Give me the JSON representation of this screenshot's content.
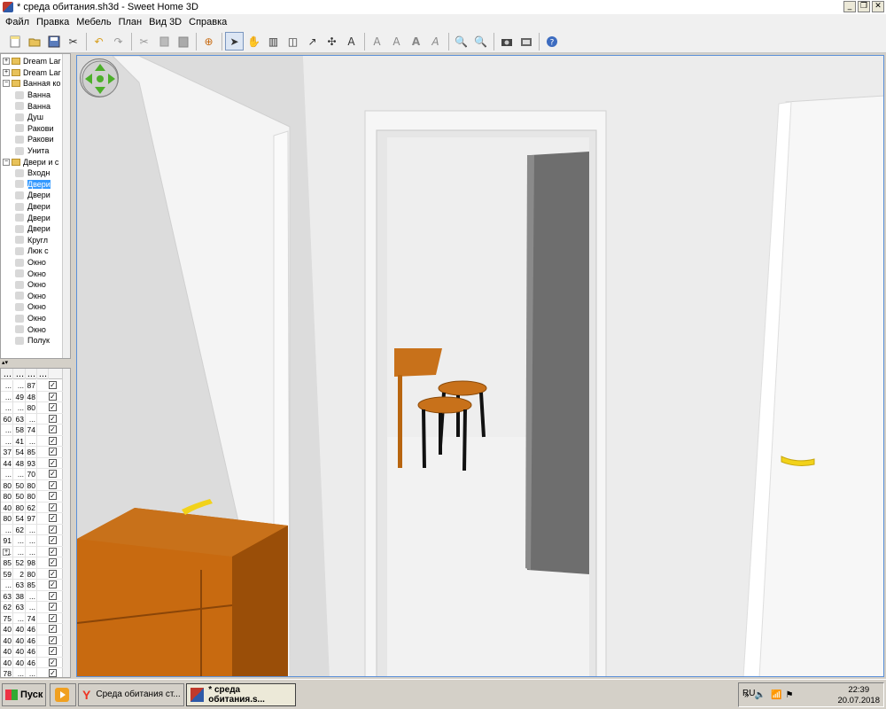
{
  "window": {
    "title": "* среда обитания.sh3d - Sweet Home 3D"
  },
  "menu": [
    "Файл",
    "Правка",
    "Мебель",
    "План",
    "Вид 3D",
    "Справка"
  ],
  "toolbar_icons": [
    "new-file-icon",
    "open-file-icon",
    "save-icon",
    "cut-icon",
    "undo-icon",
    "redo-icon",
    "cut2-icon",
    "copy-icon",
    "paste-icon",
    "add-furniture-icon",
    "select-icon",
    "pan-icon",
    "create-walls-icon",
    "create-rooms-icon",
    "create-dimensions-icon",
    "create-polylines-icon",
    "add-text-icon",
    "text-style-a-icon",
    "text-style-b-icon",
    "text-bold-icon",
    "text-italic-icon",
    "zoom-in-icon",
    "zoom-out-icon",
    "photo-icon",
    "video-icon",
    "help-icon"
  ],
  "catalog": [
    {
      "label": "Dream Lar",
      "type": "folder",
      "indent": 0,
      "exp": "+"
    },
    {
      "label": "Dream Lar",
      "type": "folder",
      "indent": 0,
      "exp": "+"
    },
    {
      "label": "Ванная ко",
      "type": "folder",
      "indent": 0,
      "exp": "−"
    },
    {
      "label": "Ванна",
      "type": "item",
      "indent": 1
    },
    {
      "label": "Ванна",
      "type": "item",
      "indent": 1
    },
    {
      "label": "Душ",
      "type": "item",
      "indent": 1
    },
    {
      "label": "Ракови",
      "type": "item",
      "indent": 1
    },
    {
      "label": "Ракови",
      "type": "item",
      "indent": 1
    },
    {
      "label": "Унита",
      "type": "item",
      "indent": 1
    },
    {
      "label": "Двери и с",
      "type": "folder",
      "indent": 0,
      "exp": "−"
    },
    {
      "label": "Входн",
      "type": "item",
      "indent": 1
    },
    {
      "label": "Двери",
      "type": "item",
      "indent": 1,
      "selected": true
    },
    {
      "label": "Двери",
      "type": "item",
      "indent": 1
    },
    {
      "label": "Двери",
      "type": "item",
      "indent": 1
    },
    {
      "label": "Двери",
      "type": "item",
      "indent": 1
    },
    {
      "label": "Двери",
      "type": "item",
      "indent": 1
    },
    {
      "label": "Кругл",
      "type": "item",
      "indent": 1
    },
    {
      "label": "Люк с",
      "type": "item",
      "indent": 1
    },
    {
      "label": "Окно",
      "type": "item",
      "indent": 1
    },
    {
      "label": "Окно",
      "type": "item",
      "indent": 1
    },
    {
      "label": "Окно",
      "type": "item",
      "indent": 1
    },
    {
      "label": "Окно",
      "type": "item",
      "indent": 1
    },
    {
      "label": "Окно",
      "type": "item",
      "indent": 1
    },
    {
      "label": "Окно",
      "type": "item",
      "indent": 1
    },
    {
      "label": "Окно",
      "type": "item",
      "indent": 1
    },
    {
      "label": "Полук",
      "type": "item",
      "indent": 1
    }
  ],
  "furniture_headers": [
    "...",
    "...",
    "...",
    ""
  ],
  "furniture_rows": [
    {
      "c": [
        "...",
        "...",
        "87"
      ],
      "checked": true
    },
    {
      "c": [
        "...",
        "49",
        "48"
      ],
      "checked": true
    },
    {
      "c": [
        "...",
        "...",
        "80"
      ],
      "checked": true
    },
    {
      "c": [
        "60",
        "63",
        "..."
      ],
      "checked": true
    },
    {
      "c": [
        "...",
        "58",
        "74"
      ],
      "checked": true
    },
    {
      "c": [
        "...",
        "41",
        "..."
      ],
      "checked": true
    },
    {
      "c": [
        "37",
        "54",
        "85"
      ],
      "checked": true
    },
    {
      "c": [
        "44",
        "48",
        "93"
      ],
      "checked": true
    },
    {
      "c": [
        "...",
        "...",
        "70"
      ],
      "checked": true
    },
    {
      "c": [
        "80",
        "50",
        "80"
      ],
      "checked": true
    },
    {
      "c": [
        "80",
        "50",
        "80"
      ],
      "checked": true
    },
    {
      "c": [
        "40",
        "80",
        "62"
      ],
      "checked": true
    },
    {
      "c": [
        "80",
        "54",
        "97"
      ],
      "checked": true
    },
    {
      "c": [
        "...",
        "62",
        "..."
      ],
      "checked": true
    },
    {
      "c": [
        "91",
        "...",
        "..."
      ],
      "checked": true
    },
    {
      "c": [
        "...",
        "...",
        "..."
      ],
      "checked": true,
      "exp": true
    },
    {
      "c": [
        "85",
        "52",
        "98"
      ],
      "checked": true
    },
    {
      "c": [
        "59",
        "2",
        "80"
      ],
      "checked": true
    },
    {
      "c": [
        "...",
        "63",
        "85"
      ],
      "checked": true
    },
    {
      "c": [
        "63",
        "38",
        "..."
      ],
      "checked": true
    },
    {
      "c": [
        "62",
        "63",
        "..."
      ],
      "checked": true
    },
    {
      "c": [
        "75",
        "...",
        "74"
      ],
      "checked": true
    },
    {
      "c": [
        "40",
        "40",
        "46"
      ],
      "checked": true
    },
    {
      "c": [
        "40",
        "40",
        "46"
      ],
      "checked": true
    },
    {
      "c": [
        "40",
        "40",
        "46"
      ],
      "checked": true
    },
    {
      "c": [
        "40",
        "40",
        "46"
      ],
      "checked": true
    },
    {
      "c": [
        "78",
        "...",
        "..."
      ],
      "checked": true
    }
  ],
  "taskbar": {
    "start_label": "Пуск",
    "tasks": [
      {
        "label": "",
        "icon": "media-player-icon",
        "active": false
      },
      {
        "label": "Среда обитания ст...",
        "icon": "yandex-browser-icon",
        "active": false
      },
      {
        "label": "* среда обитания.s...",
        "icon": "sweet-home-icon",
        "active": true
      }
    ],
    "lang": "RU",
    "time": "22:39",
    "date": "20.07.2018"
  },
  "colors": {
    "selection": "#3399ff",
    "wood": "#c86a10",
    "door_gray": "#6e6e6e",
    "handle": "#f2d21a"
  }
}
